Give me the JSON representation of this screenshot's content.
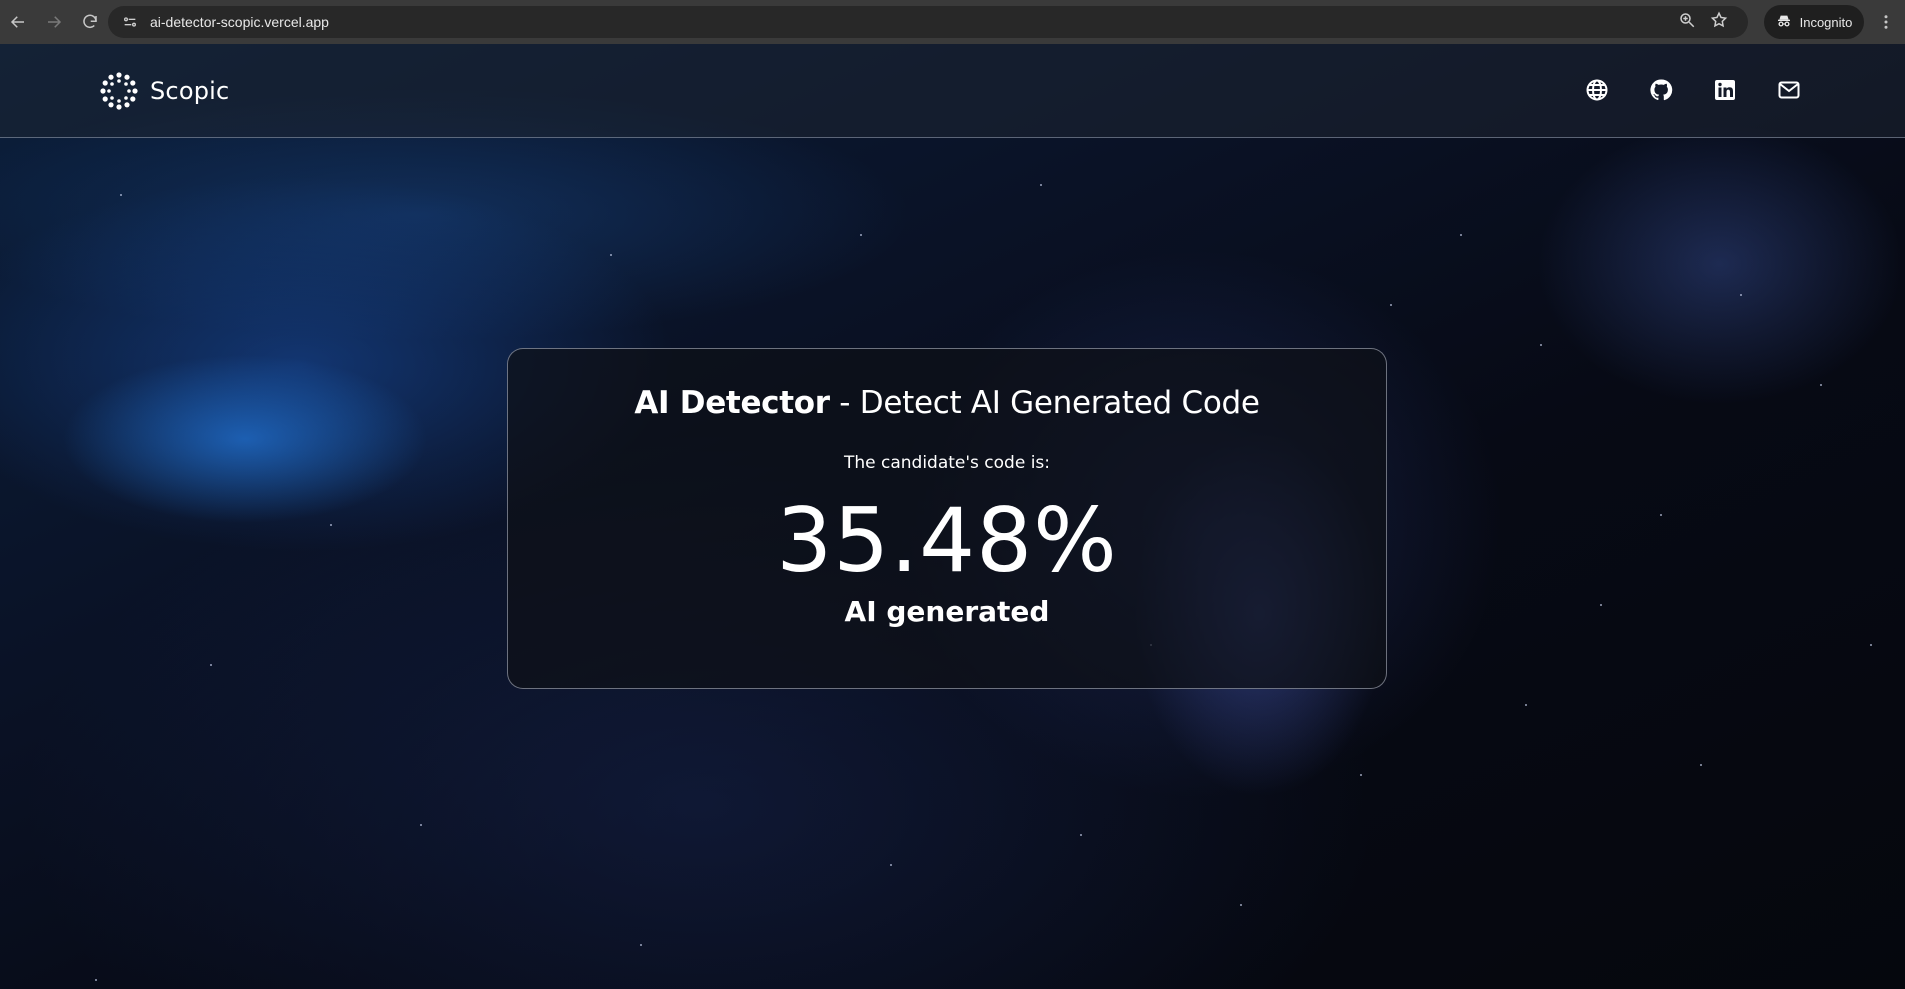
{
  "browser": {
    "url": "ai-detector-scopic.vercel.app",
    "profile_label": "Incognito",
    "icons": [
      "back-arrow-icon",
      "forward-arrow-icon",
      "reload-icon",
      "site-info-icon",
      "zoom-icon",
      "bookmark-star-icon",
      "incognito-icon",
      "more-menu-icon"
    ]
  },
  "header": {
    "brand": "Scopic",
    "nav_icons": [
      "globe-icon",
      "github-icon",
      "linkedin-icon",
      "mail-icon"
    ]
  },
  "result": {
    "title_strong": "AI Detector",
    "title_rest": " - Detect AI Generated Code",
    "subtitle": "The candidate's code is:",
    "percentage": "35.48%",
    "label": "AI generated"
  },
  "colors": {
    "text": "#ffffff",
    "card_border": "#bec3d2",
    "background": "#05070d",
    "nebula_blue": "#2a8cff"
  }
}
